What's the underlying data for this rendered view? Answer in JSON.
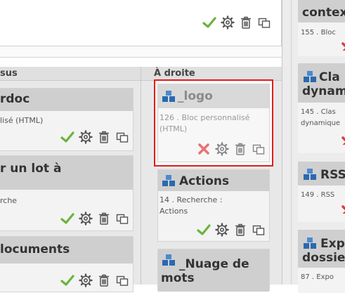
{
  "top_panel": {
    "actions": [
      "check-icon",
      "gear-icon",
      "trash-icon",
      "layer-icon"
    ]
  },
  "left_region": {
    "column_title": "sus",
    "blocks": [
      {
        "title": "rdoc",
        "desc": "lisé (HTML)"
      },
      {
        "title": "r un lot à",
        "desc": "rche"
      },
      {
        "title": "locuments",
        "desc": ""
      }
    ]
  },
  "middle_region": {
    "column_title": "À droite",
    "blocks": [
      {
        "title": "_logo",
        "desc_line1": "126 . Bloc personnalisé",
        "desc_line2": "(HTML)",
        "selected": true
      },
      {
        "title": "Actions",
        "desc_line1": "14 . Recherche :",
        "desc_line2": "Actions"
      },
      {
        "title_line1": "_Nuage de",
        "title_line2": "mots"
      }
    ]
  },
  "right_region": {
    "blocks": [
      {
        "title": "contex",
        "desc": "155 . Bloc"
      },
      {
        "title_line1": "Cla",
        "title_line2": "dynam",
        "desc_line1": "145 . Clas",
        "desc_line2": "dynamique"
      },
      {
        "title": "RSS",
        "desc": "149 . RSS"
      },
      {
        "title_line1": "Exp",
        "title_line2": "dossie",
        "desc": "87 . Expo"
      }
    ]
  },
  "colors": {
    "check": "#6cb33e",
    "cross": "#e53b3b",
    "block_icon": "#3a78b8",
    "selection_border": "#e21b1b"
  }
}
